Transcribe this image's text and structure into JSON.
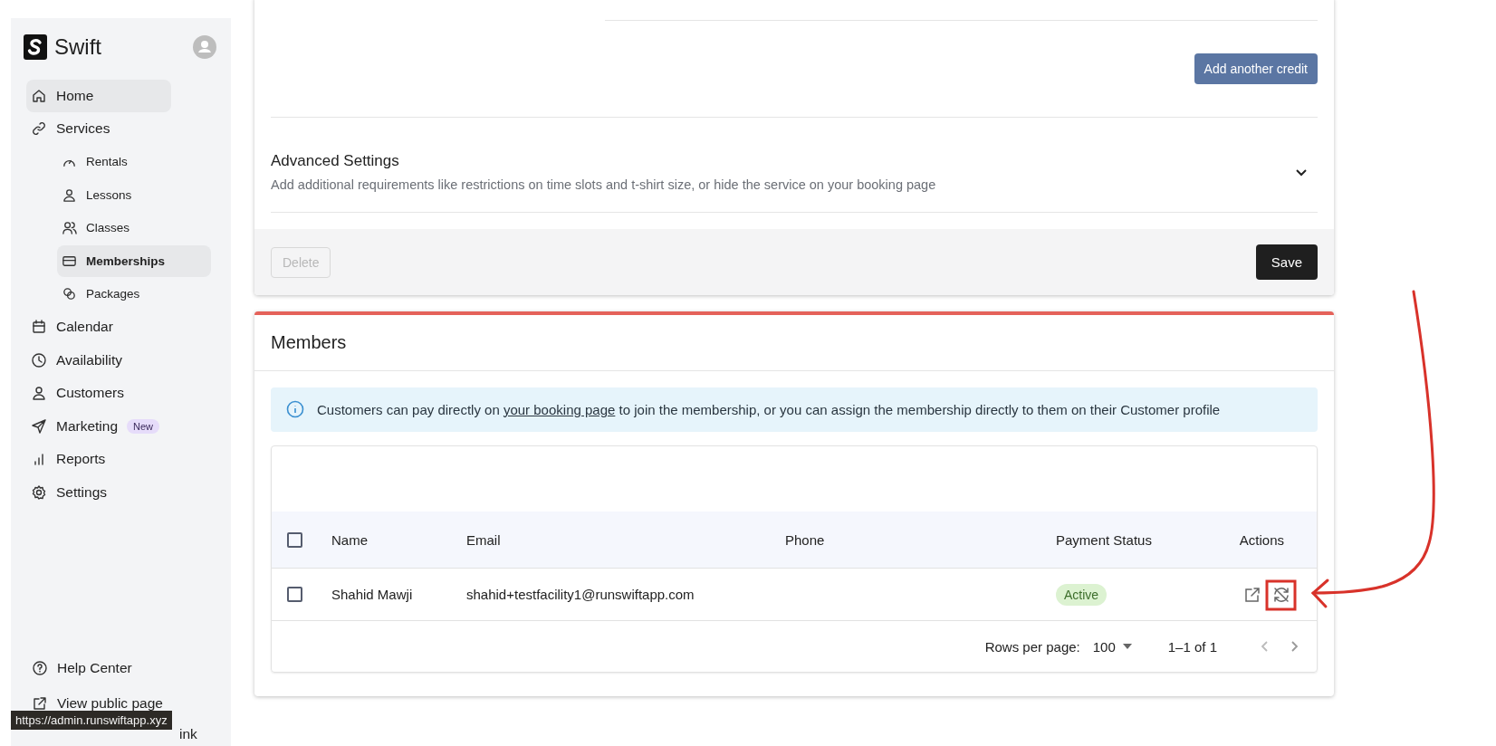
{
  "sidebar": {
    "brand": "Swift",
    "items": [
      {
        "label": "Home",
        "selected": true
      },
      {
        "label": "Services",
        "selected": false,
        "children": [
          {
            "label": "Rentals",
            "selected": false
          },
          {
            "label": "Lessons",
            "selected": false
          },
          {
            "label": "Classes",
            "selected": false
          },
          {
            "label": "Memberships",
            "selected": true
          },
          {
            "label": "Packages",
            "selected": false
          }
        ]
      },
      {
        "label": "Calendar",
        "selected": false
      },
      {
        "label": "Availability",
        "selected": false
      },
      {
        "label": "Customers",
        "selected": false
      },
      {
        "label": "Marketing",
        "selected": false,
        "badge": "New"
      },
      {
        "label": "Reports",
        "selected": false
      },
      {
        "label": "Settings",
        "selected": false
      }
    ],
    "bottom_links": [
      "Help Center",
      "View public page"
    ],
    "covered_link_fragment": "ink",
    "status_tooltip": "https://admin.runswiftapp.xyz"
  },
  "service_card": {
    "add_credit_button": "Add another credit",
    "advanced_settings": {
      "title": "Advanced Settings",
      "description": "Add additional requirements like restrictions on time slots and t-shirt size, or hide the service on your booking page",
      "expanded": false
    },
    "delete_button": {
      "label": "Delete",
      "disabled": true
    },
    "save_button": "Save"
  },
  "members": {
    "title": "Members",
    "info": "Customers can pay directly on ",
    "info_link": "your booking page",
    "info_rest": " to join the membership, or you can assign the membership directly to them on their Customer profile",
    "table": {
      "select_all_checked": false,
      "columns": [
        "Name",
        "Email",
        "Phone",
        "Payment Status",
        "Actions"
      ],
      "rows": [
        {
          "checked": false,
          "name": "Shahid Mawji",
          "email": "shahid+testfacility1@runswiftapp.com",
          "payment_status": "Active"
        }
      ],
      "rows_per_page_label": "Rows per page:",
      "rows_per_page": "100",
      "range": "1–1 of 1"
    }
  }
}
